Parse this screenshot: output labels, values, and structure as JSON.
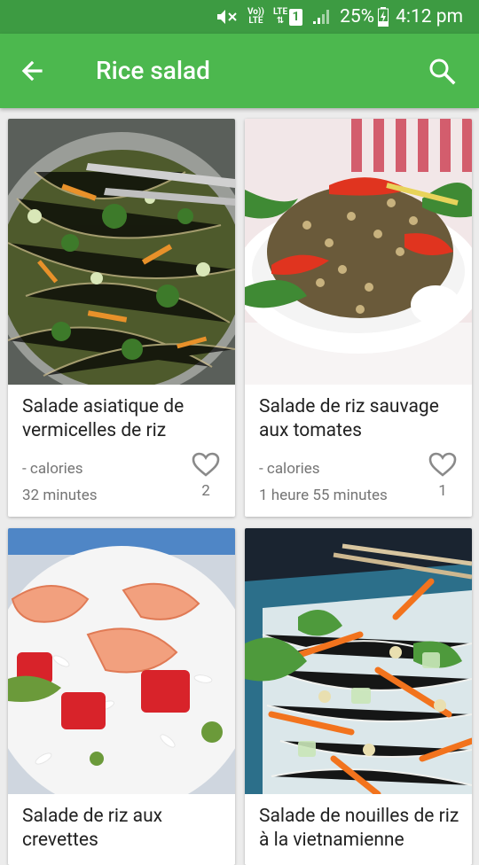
{
  "status_bar": {
    "volte_label_top": "Vo))",
    "volte_label_bottom": "LTE",
    "lte_label": "LTE",
    "sim_number": "1",
    "battery_percent": "25%",
    "time": "4:12 pm"
  },
  "app_bar": {
    "title": "Rice salad"
  },
  "recipes": [
    {
      "title": "Salade asiatique de vermicelles de riz",
      "calories": "- calories",
      "duration": "32 minutes",
      "likes": "2"
    },
    {
      "title": "Salade de riz sauvage aux tomates",
      "calories": "- calories",
      "duration": "1 heure 55 minutes",
      "likes": "1"
    },
    {
      "title": "Salade de riz aux crevettes"
    },
    {
      "title": "Salade de nouilles de riz à la vietnamienne"
    }
  ],
  "colors": {
    "status_bar": "#3d9b42",
    "app_bar": "#4cb84e",
    "background": "#ececec"
  }
}
